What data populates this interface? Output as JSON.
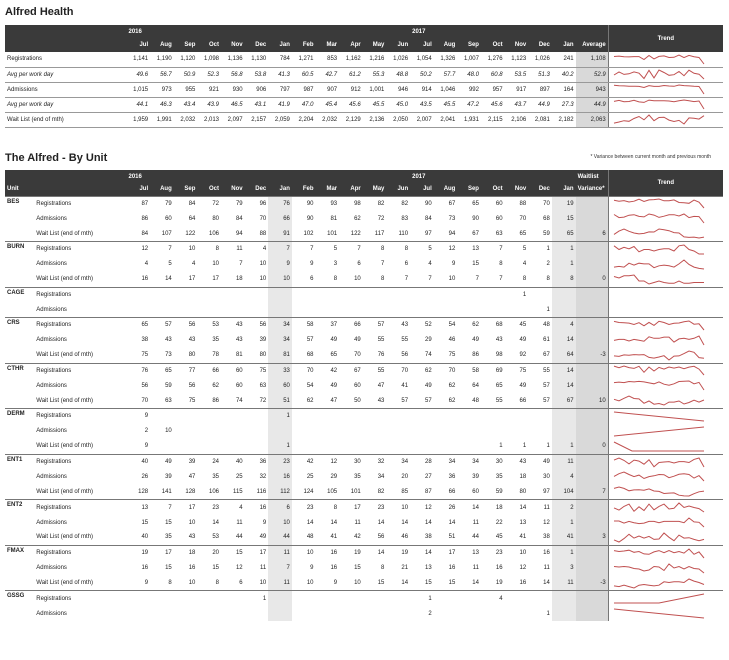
{
  "title1": "Alfred Health",
  "title2": "The Alfred - By Unit",
  "note": "* Variance between current month and previous month",
  "years": [
    "2016",
    "2017"
  ],
  "months": [
    "Jul",
    "Aug",
    "Sep",
    "Oct",
    "Nov",
    "Dec",
    "Jan",
    "Feb",
    "Mar",
    "Apr",
    "May",
    "Jun",
    "Jul",
    "Aug",
    "Sep",
    "Oct",
    "Nov",
    "Dec",
    "Jan"
  ],
  "avg_label": "Average",
  "trend_label": "Trend",
  "unit_label": "Unit",
  "waitlist_label": "Waitlist",
  "variance_label": "Variance*",
  "trend_color": "#c05050",
  "summary": [
    {
      "label": "Registrations",
      "italic": false,
      "vals": [
        "1,141",
        "1,190",
        "1,120",
        "1,098",
        "1,136",
        "1,130",
        "784",
        "1,271",
        "853",
        "1,162",
        "1,216",
        "1,026",
        "1,054",
        "1,326",
        "1,007",
        "1,276",
        "1,123",
        "1,026",
        "241"
      ],
      "avg": "1,108",
      "trend": [
        1141,
        1190,
        1120,
        1098,
        1136,
        1130,
        784,
        1271,
        853,
        1162,
        1216,
        1026,
        1054,
        1326,
        1007,
        1276,
        1123,
        1026,
        241
      ]
    },
    {
      "label": "Avg per work day",
      "italic": true,
      "vals": [
        "49.6",
        "56.7",
        "50.9",
        "52.3",
        "56.8",
        "53.8",
        "41.3",
        "60.5",
        "42.7",
        "61.2",
        "55.3",
        "48.8",
        "50.2",
        "57.7",
        "48.0",
        "60.8",
        "53.5",
        "51.3",
        "40.2"
      ],
      "avg": "52.9",
      "trend": [
        49.6,
        56.7,
        50.9,
        52.3,
        56.8,
        53.8,
        41.3,
        60.5,
        42.7,
        61.2,
        55.3,
        48.8,
        50.2,
        57.7,
        48,
        60.8,
        53.5,
        51.3,
        40.2
      ]
    },
    {
      "label": "Admissions",
      "italic": false,
      "vals": [
        "1,015",
        "973",
        "955",
        "921",
        "930",
        "906",
        "797",
        "987",
        "907",
        "912",
        "1,001",
        "946",
        "914",
        "1,046",
        "992",
        "957",
        "917",
        "897",
        "164"
      ],
      "avg": "943",
      "trend": [
        1015,
        973,
        955,
        921,
        930,
        906,
        797,
        987,
        907,
        912,
        1001,
        946,
        914,
        1046,
        992,
        957,
        917,
        897,
        164
      ]
    },
    {
      "label": "Avg per work day",
      "italic": true,
      "vals": [
        "44.1",
        "46.3",
        "43.4",
        "43.9",
        "46.5",
        "43.1",
        "41.9",
        "47.0",
        "45.4",
        "45.6",
        "45.5",
        "45.0",
        "43.5",
        "45.5",
        "47.2",
        "45.6",
        "43.7",
        "44.9",
        "27.3"
      ],
      "avg": "44.9",
      "trend": [
        44.1,
        46.3,
        43.4,
        43.9,
        46.5,
        43.1,
        41.9,
        47,
        45.4,
        45.6,
        45.5,
        45,
        43.5,
        45.5,
        47.2,
        45.6,
        43.7,
        44.9,
        27.3
      ]
    },
    {
      "label": "Wait List (end of mth)",
      "italic": false,
      "vals": [
        "1,959",
        "1,991",
        "2,032",
        "2,013",
        "2,097",
        "2,157",
        "2,059",
        "2,204",
        "2,032",
        "2,129",
        "2,136",
        "2,050",
        "2,007",
        "2,041",
        "1,931",
        "2,115",
        "2,106",
        "2,081",
        "2,182"
      ],
      "avg": "2,063",
      "trend": [
        1959,
        1991,
        2032,
        2013,
        2097,
        2157,
        2059,
        2204,
        2032,
        2129,
        2136,
        2050,
        2007,
        2041,
        1931,
        2115,
        2106,
        2081,
        2182
      ]
    }
  ],
  "units": [
    {
      "unit": "BES",
      "rows": [
        {
          "label": "Registrations",
          "vals": [
            "87",
            "79",
            "84",
            "72",
            "79",
            "96",
            "76",
            "90",
            "93",
            "98",
            "82",
            "82",
            "90",
            "67",
            "65",
            "60",
            "88",
            "70",
            "19"
          ],
          "var": ""
        },
        {
          "label": "Admissions",
          "vals": [
            "86",
            "60",
            "64",
            "80",
            "84",
            "70",
            "66",
            "90",
            "81",
            "62",
            "72",
            "83",
            "84",
            "73",
            "90",
            "60",
            "70",
            "68",
            "15"
          ],
          "var": ""
        },
        {
          "label": "Wait List (end of mth)",
          "vals": [
            "84",
            "107",
            "122",
            "106",
            "94",
            "88",
            "91",
            "102",
            "101",
            "122",
            "117",
            "110",
            "97",
            "94",
            "67",
            "63",
            "65",
            "59",
            "65"
          ],
          "var": "6"
        }
      ]
    },
    {
      "unit": "BURN",
      "rows": [
        {
          "label": "Registrations",
          "vals": [
            "12",
            "7",
            "10",
            "8",
            "11",
            "4",
            "7",
            "7",
            "5",
            "7",
            "8",
            "8",
            "5",
            "12",
            "13",
            "7",
            "5",
            "1",
            "1"
          ],
          "var": ""
        },
        {
          "label": "Admissions",
          "vals": [
            "4",
            "5",
            "4",
            "10",
            "7",
            "10",
            "9",
            "9",
            "3",
            "6",
            "7",
            "6",
            "4",
            "9",
            "15",
            "8",
            "4",
            "2",
            "1"
          ],
          "var": ""
        },
        {
          "label": "Wait List (end of mth)",
          "vals": [
            "16",
            "14",
            "17",
            "17",
            "18",
            "10",
            "10",
            "6",
            "8",
            "10",
            "8",
            "7",
            "7",
            "10",
            "7",
            "7",
            "8",
            "8",
            "8"
          ],
          "var": "0"
        }
      ]
    },
    {
      "unit": "CAGE",
      "rows": [
        {
          "label": "Registrations",
          "vals": [
            "",
            "",
            "",
            "",
            "",
            "",
            "",
            "",
            "",
            "",
            "",
            "",
            "",
            "",
            "",
            "",
            "1",
            "",
            ""
          ],
          "var": ""
        },
        {
          "label": "Admissions",
          "vals": [
            "",
            "",
            "",
            "",
            "",
            "",
            "",
            "",
            "",
            "",
            "",
            "",
            "",
            "",
            "",
            "",
            "",
            "1",
            ""
          ],
          "var": ""
        }
      ]
    },
    {
      "unit": "CRS",
      "rows": [
        {
          "label": "Registrations",
          "vals": [
            "65",
            "57",
            "56",
            "53",
            "43",
            "56",
            "34",
            "58",
            "37",
            "66",
            "57",
            "43",
            "52",
            "54",
            "62",
            "68",
            "45",
            "48",
            "4"
          ],
          "var": ""
        },
        {
          "label": "Admissions",
          "vals": [
            "38",
            "43",
            "43",
            "35",
            "43",
            "39",
            "34",
            "57",
            "49",
            "49",
            "55",
            "55",
            "29",
            "46",
            "49",
            "43",
            "49",
            "61",
            "14"
          ],
          "var": ""
        },
        {
          "label": "Wait List (end of mth)",
          "vals": [
            "75",
            "73",
            "80",
            "78",
            "81",
            "80",
            "81",
            "68",
            "65",
            "70",
            "76",
            "56",
            "74",
            "75",
            "86",
            "98",
            "92",
            "67",
            "64"
          ],
          "var": "-3"
        }
      ]
    },
    {
      "unit": "CTHR",
      "rows": [
        {
          "label": "Registrations",
          "vals": [
            "76",
            "65",
            "77",
            "66",
            "60",
            "75",
            "33",
            "70",
            "42",
            "67",
            "55",
            "70",
            "62",
            "70",
            "58",
            "69",
            "75",
            "55",
            "14"
          ],
          "var": ""
        },
        {
          "label": "Admissions",
          "vals": [
            "56",
            "59",
            "56",
            "62",
            "60",
            "63",
            "60",
            "54",
            "49",
            "60",
            "47",
            "41",
            "49",
            "62",
            "64",
            "65",
            "49",
            "57",
            "14"
          ],
          "var": ""
        },
        {
          "label": "Wait List (end of mth)",
          "vals": [
            "70",
            "63",
            "75",
            "86",
            "74",
            "72",
            "51",
            "62",
            "47",
            "50",
            "43",
            "57",
            "57",
            "62",
            "48",
            "55",
            "66",
            "57",
            "67"
          ],
          "var": "10"
        }
      ]
    },
    {
      "unit": "DERM",
      "rows": [
        {
          "label": "Registrations",
          "vals": [
            "9",
            "",
            "",
            "",
            "",
            "",
            "1",
            "",
            "",
            "",
            "",
            "",
            "",
            "",
            "",
            "",
            "",
            "",
            ""
          ],
          "var": ""
        },
        {
          "label": "Admissions",
          "vals": [
            "2",
            "10",
            "",
            "",
            "",
            "",
            "",
            "",
            "",
            "",
            "",
            "",
            "",
            "",
            "",
            "",
            "",
            "",
            ""
          ],
          "var": ""
        },
        {
          "label": "Wait List (end of mth)",
          "vals": [
            "9",
            "",
            "",
            "",
            "",
            "",
            "1",
            "",
            "",
            "",
            "",
            "",
            "",
            "",
            "",
            "1",
            "1",
            "1",
            "1"
          ],
          "var": "0"
        }
      ]
    },
    {
      "unit": "ENT1",
      "rows": [
        {
          "label": "Registrations",
          "vals": [
            "40",
            "49",
            "39",
            "24",
            "40",
            "36",
            "23",
            "42",
            "12",
            "30",
            "32",
            "34",
            "28",
            "34",
            "34",
            "30",
            "43",
            "49",
            "11"
          ],
          "var": ""
        },
        {
          "label": "Admissions",
          "vals": [
            "26",
            "39",
            "47",
            "35",
            "25",
            "32",
            "16",
            "25",
            "29",
            "35",
            "34",
            "20",
            "27",
            "36",
            "39",
            "35",
            "18",
            "30",
            "4"
          ],
          "var": ""
        },
        {
          "label": "Wait List (end of mth)",
          "vals": [
            "128",
            "141",
            "128",
            "106",
            "115",
            "116",
            "112",
            "124",
            "105",
            "101",
            "82",
            "85",
            "87",
            "66",
            "60",
            "59",
            "80",
            "97",
            "104"
          ],
          "var": "7"
        }
      ]
    },
    {
      "unit": "ENT2",
      "rows": [
        {
          "label": "Registrations",
          "vals": [
            "13",
            "7",
            "17",
            "23",
            "4",
            "16",
            "6",
            "23",
            "8",
            "17",
            "23",
            "10",
            "12",
            "26",
            "14",
            "18",
            "14",
            "11",
            "2"
          ],
          "var": ""
        },
        {
          "label": "Admissions",
          "vals": [
            "15",
            "15",
            "10",
            "14",
            "11",
            "9",
            "10",
            "14",
            "14",
            "11",
            "14",
            "14",
            "14",
            "14",
            "11",
            "22",
            "13",
            "12",
            "1"
          ],
          "var": ""
        },
        {
          "label": "Wait List (end of mth)",
          "vals": [
            "40",
            "35",
            "43",
            "53",
            "44",
            "49",
            "44",
            "48",
            "41",
            "42",
            "56",
            "46",
            "38",
            "51",
            "44",
            "45",
            "41",
            "38",
            "41"
          ],
          "var": "3"
        }
      ]
    },
    {
      "unit": "FMAX",
      "rows": [
        {
          "label": "Registrations",
          "vals": [
            "19",
            "17",
            "18",
            "20",
            "15",
            "17",
            "11",
            "10",
            "16",
            "19",
            "14",
            "19",
            "14",
            "17",
            "13",
            "23",
            "10",
            "16",
            "1"
          ],
          "var": ""
        },
        {
          "label": "Admissions",
          "vals": [
            "16",
            "15",
            "16",
            "15",
            "12",
            "11",
            "7",
            "9",
            "16",
            "15",
            "8",
            "21",
            "13",
            "16",
            "11",
            "16",
            "12",
            "11",
            "3"
          ],
          "var": ""
        },
        {
          "label": "Wait List (end of mth)",
          "vals": [
            "9",
            "8",
            "10",
            "8",
            "6",
            "10",
            "11",
            "10",
            "9",
            "10",
            "15",
            "14",
            "15",
            "15",
            "14",
            "19",
            "16",
            "14",
            "11"
          ],
          "var": "-3"
        }
      ]
    },
    {
      "unit": "GSSG",
      "rows": [
        {
          "label": "Registrations",
          "vals": [
            "",
            "",
            "",
            "",
            "",
            "1",
            "",
            "",
            "",
            "",
            "",
            "",
            "1",
            "",
            "",
            "4",
            "",
            "",
            ""
          ],
          "var": ""
        },
        {
          "label": "Admissions",
          "vals": [
            "",
            "",
            "",
            "",
            "",
            "",
            "",
            "",
            "",
            "",
            "",
            "",
            "2",
            "",
            "",
            "",
            "",
            "1",
            ""
          ],
          "var": ""
        }
      ]
    }
  ]
}
